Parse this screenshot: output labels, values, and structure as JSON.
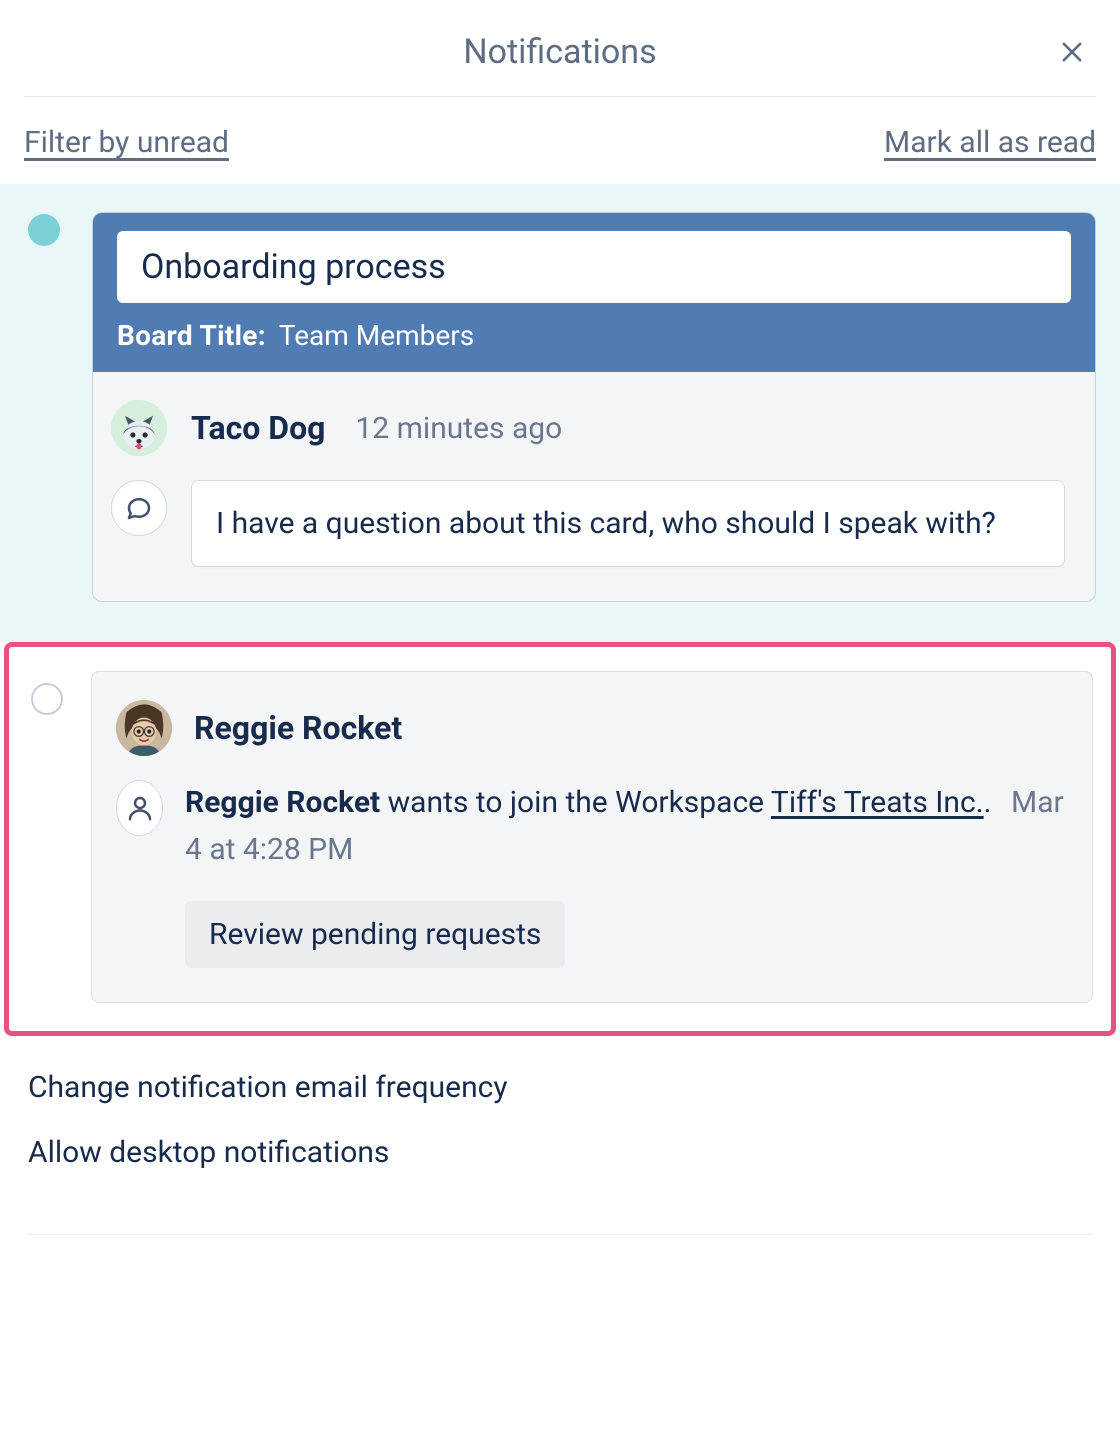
{
  "header": {
    "title": "Notifications",
    "close_icon": "close"
  },
  "filters": {
    "filter_unread_label": "Filter by unread",
    "mark_all_label": "Mark all as read"
  },
  "notifications": [
    {
      "unread": true,
      "card": {
        "title": "Onboarding process",
        "board_label": "Board Title:",
        "board_value": "Team Members"
      },
      "author": {
        "name": "Taco Dog",
        "avatar_icon": "husky-dog"
      },
      "timestamp": "12 minutes ago",
      "comment_icon": "speech-bubble",
      "comment_text": "I have a question about this card, who should I speak with?"
    },
    {
      "unread": false,
      "highlighted": true,
      "author": {
        "name": "Reggie Rocket",
        "avatar_icon": "photo-avatar"
      },
      "request": {
        "person_icon": "person",
        "requester_name": "Reggie Rocket",
        "request_text_mid": "wants to join the Workspace",
        "workspace_name": "Tiff's Treats Inc.",
        "timestamp": "Mar 4 at 4:28 PM",
        "action_label": "Review pending requests"
      }
    }
  ],
  "footer": {
    "change_frequency_label": "Change notification email frequency",
    "allow_desktop_label": "Allow desktop notifications"
  }
}
